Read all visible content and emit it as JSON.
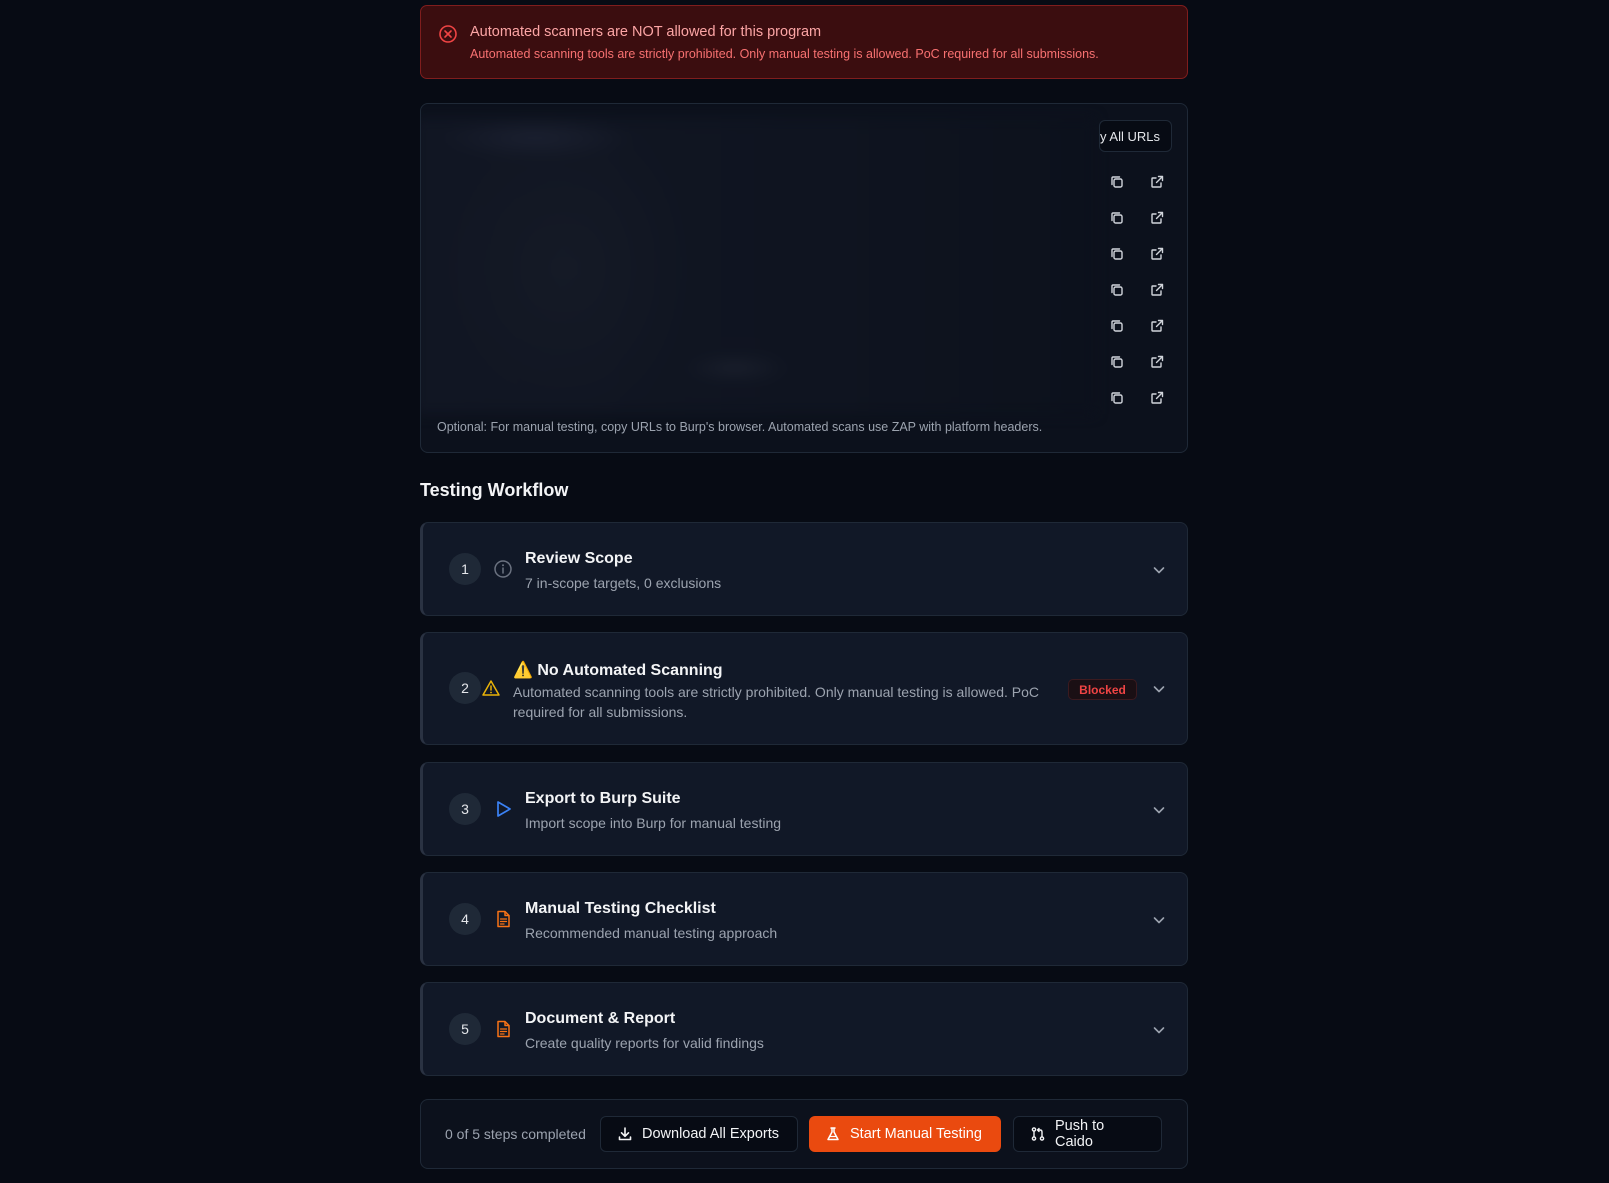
{
  "alert": {
    "title": "Automated scanners are NOT allowed for this program",
    "description": "Automated scanning tools are strictly prohibited. Only manual testing is allowed. PoC required for all submissions."
  },
  "urls": {
    "copy_all_label": "y All URLs",
    "row_count": 7,
    "note": "Optional: For manual testing, copy URLs to Burp's browser. Automated scans use ZAP with platform headers."
  },
  "workflow": {
    "title": "Testing Workflow",
    "steps": [
      {
        "number": "1",
        "title": "Review Scope",
        "description": "7 in-scope targets, 0 exclusions",
        "icon": "info-icon"
      },
      {
        "number": "2",
        "title": "⚠️ No Automated Scanning",
        "description": "Automated scanning tools are strictly prohibited. Only manual testing is allowed. PoC required for all submissions.",
        "badge": "Blocked",
        "icon": "warning-icon"
      },
      {
        "number": "3",
        "title": "Export to Burp Suite",
        "description": "Import scope into Burp for manual testing",
        "icon": "play-icon"
      },
      {
        "number": "4",
        "title": "Manual Testing Checklist",
        "description": "Recommended manual testing approach",
        "icon": "document-icon"
      },
      {
        "number": "5",
        "title": "Document & Report",
        "description": "Create quality reports for valid findings",
        "icon": "document-icon"
      }
    ]
  },
  "footer": {
    "progress": "0 of 5 steps completed",
    "download_label": "Download All Exports",
    "start_label": "Start Manual Testing",
    "caido_label": "Push to Caido"
  },
  "colors": {
    "accent": "#ea4a0f",
    "danger": "#ef4444",
    "warning": "#eab308",
    "info_blue": "#3b82f6"
  }
}
